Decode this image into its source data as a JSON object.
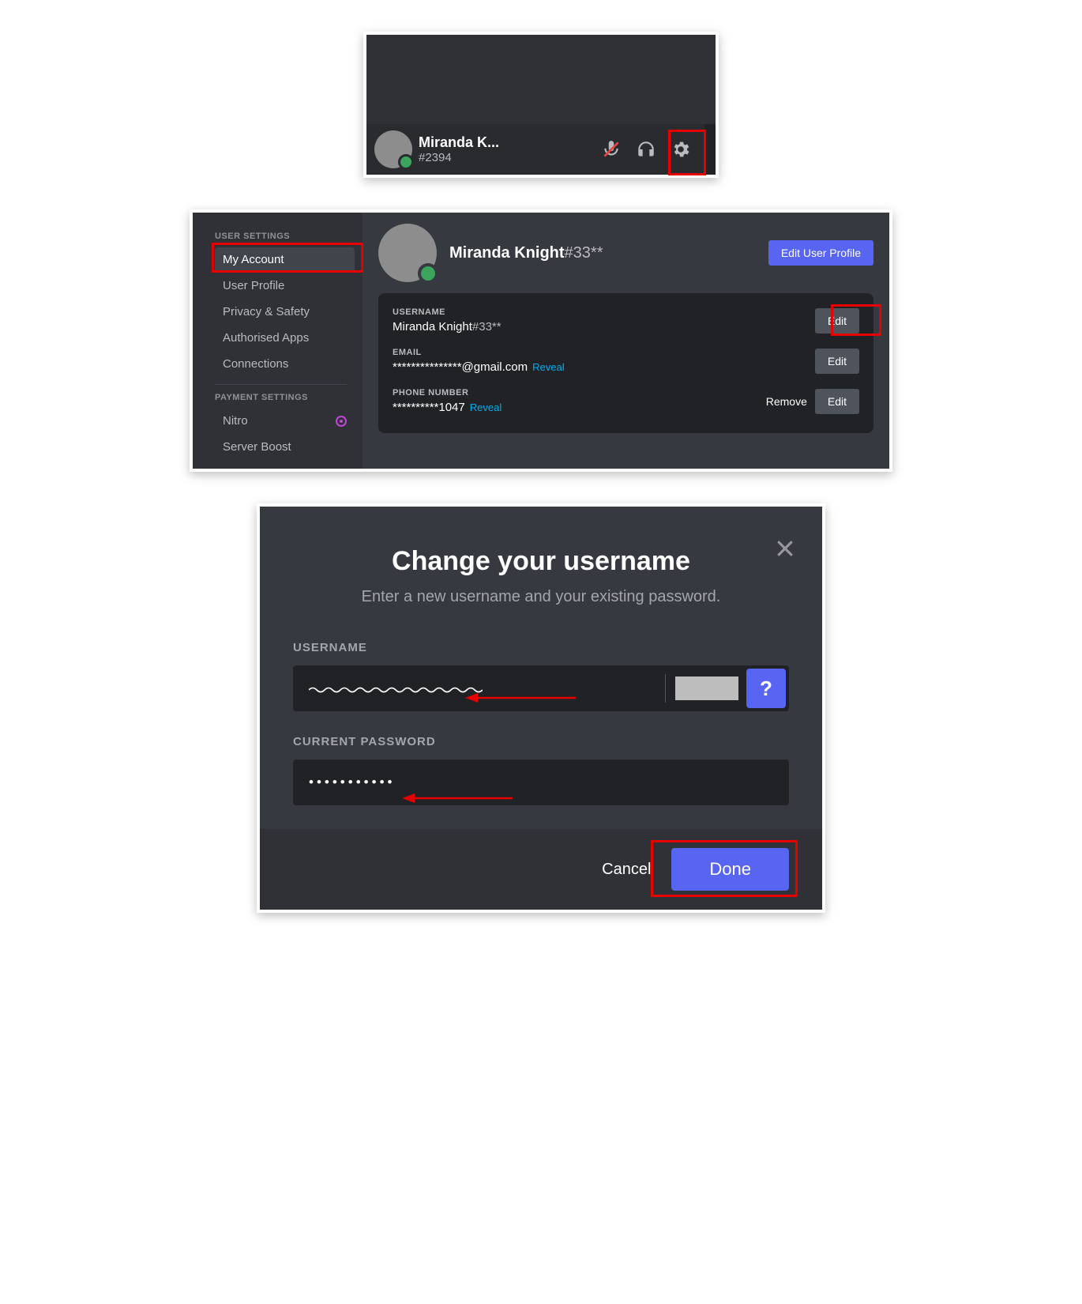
{
  "panel1": {
    "username": "Miranda K...",
    "tag": "#2394"
  },
  "panel2": {
    "sidebar": {
      "header1": "USER SETTINGS",
      "items1": [
        "My Account",
        "User Profile",
        "Privacy & Safety",
        "Authorised Apps",
        "Connections"
      ],
      "header2": "PAYMENT SETTINGS",
      "items2": [
        "Nitro",
        "Server Boost"
      ]
    },
    "profile": {
      "name": "Miranda Knight",
      "discrim": "#33**",
      "edit_profile": "Edit User Profile"
    },
    "fields": {
      "username_label": "USERNAME",
      "username_value": "Miranda Knight",
      "username_discrim": "#33**",
      "email_label": "EMAIL",
      "email_value": "***************@gmail.com",
      "email_reveal": "Reveal",
      "phone_label": "PHONE NUMBER",
      "phone_value": "**********1047",
      "phone_reveal": "Reveal",
      "edit": "Edit",
      "remove": "Remove"
    }
  },
  "panel3": {
    "title": "Change your username",
    "subtitle": "Enter a new username and your existing password.",
    "username_label": "USERNAME",
    "password_label": "CURRENT PASSWORD",
    "password_value": "•••••••••••",
    "help": "?",
    "cancel": "Cancel",
    "done": "Done"
  }
}
